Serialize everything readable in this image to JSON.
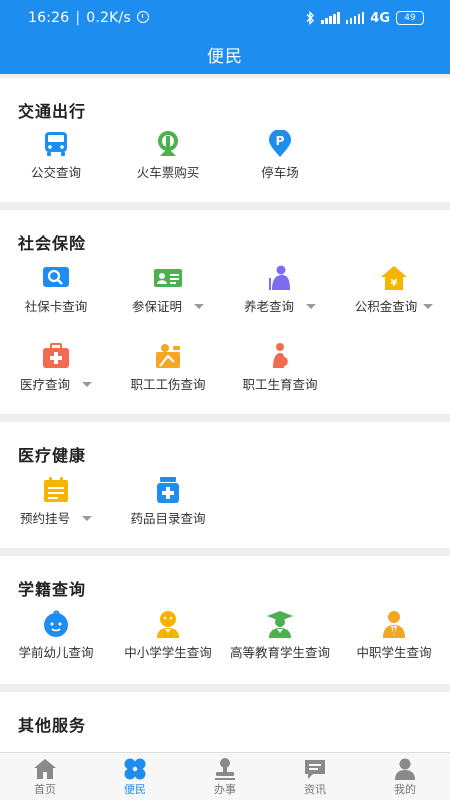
{
  "status_bar": {
    "time": "16:26",
    "speed": "0.2K/s",
    "network": "4G",
    "battery": "49"
  },
  "header": {
    "title": "便民"
  },
  "sections": [
    {
      "title": "交通出行",
      "items": [
        {
          "label": "公交查询",
          "icon": "bus-icon",
          "color": "#1e8df0"
        },
        {
          "label": "火车票购买",
          "icon": "train-icon",
          "color": "#4caf50"
        },
        {
          "label": "停车场",
          "icon": "parking-icon",
          "color": "#1e8df0"
        }
      ]
    },
    {
      "title": "社会保险",
      "items": [
        {
          "label": "社保卡查询",
          "icon": "card-search-icon",
          "color": "#1e8df0"
        },
        {
          "label": "参保证明",
          "icon": "id-card-icon",
          "color": "#4caf50",
          "dropdown": true
        },
        {
          "label": "养老查询",
          "icon": "elderly-icon",
          "color": "#7b6cf0",
          "dropdown": true
        },
        {
          "label": "公积金查询",
          "icon": "house-fund-icon",
          "color": "#f5b400",
          "dropdown": true
        },
        {
          "label": "医疗查询",
          "icon": "medical-kit-icon",
          "color": "#f26a4f",
          "dropdown": true
        },
        {
          "label": "职工工伤查询",
          "icon": "injury-icon",
          "color": "#f5a623"
        },
        {
          "label": "职工生育查询",
          "icon": "maternity-icon",
          "color": "#f26a4f"
        }
      ]
    },
    {
      "title": "医疗健康",
      "items": [
        {
          "label": "预约挂号",
          "icon": "calendar-icon",
          "color": "#f5b400",
          "dropdown": true
        },
        {
          "label": "药品目录查询",
          "icon": "medicine-icon",
          "color": "#1e8df0"
        }
      ]
    },
    {
      "title": "学籍查询",
      "items": [
        {
          "label": "学前幼儿查询",
          "icon": "baby-icon",
          "color": "#1e8df0"
        },
        {
          "label": "中小学学生查询",
          "icon": "student-icon",
          "color": "#f5b400"
        },
        {
          "label": "高等教育学生查询",
          "icon": "graduate-icon",
          "color": "#4caf50"
        },
        {
          "label": "中职学生查询",
          "icon": "vocational-icon",
          "color": "#f5a623"
        }
      ]
    },
    {
      "title": "其他服务",
      "items": []
    }
  ],
  "tabs": [
    {
      "label": "首页",
      "icon": "home-icon"
    },
    {
      "label": "便民",
      "icon": "grid-icon",
      "active": true
    },
    {
      "label": "办事",
      "icon": "stamp-icon"
    },
    {
      "label": "资讯",
      "icon": "message-icon"
    },
    {
      "label": "我的",
      "icon": "user-icon"
    }
  ]
}
